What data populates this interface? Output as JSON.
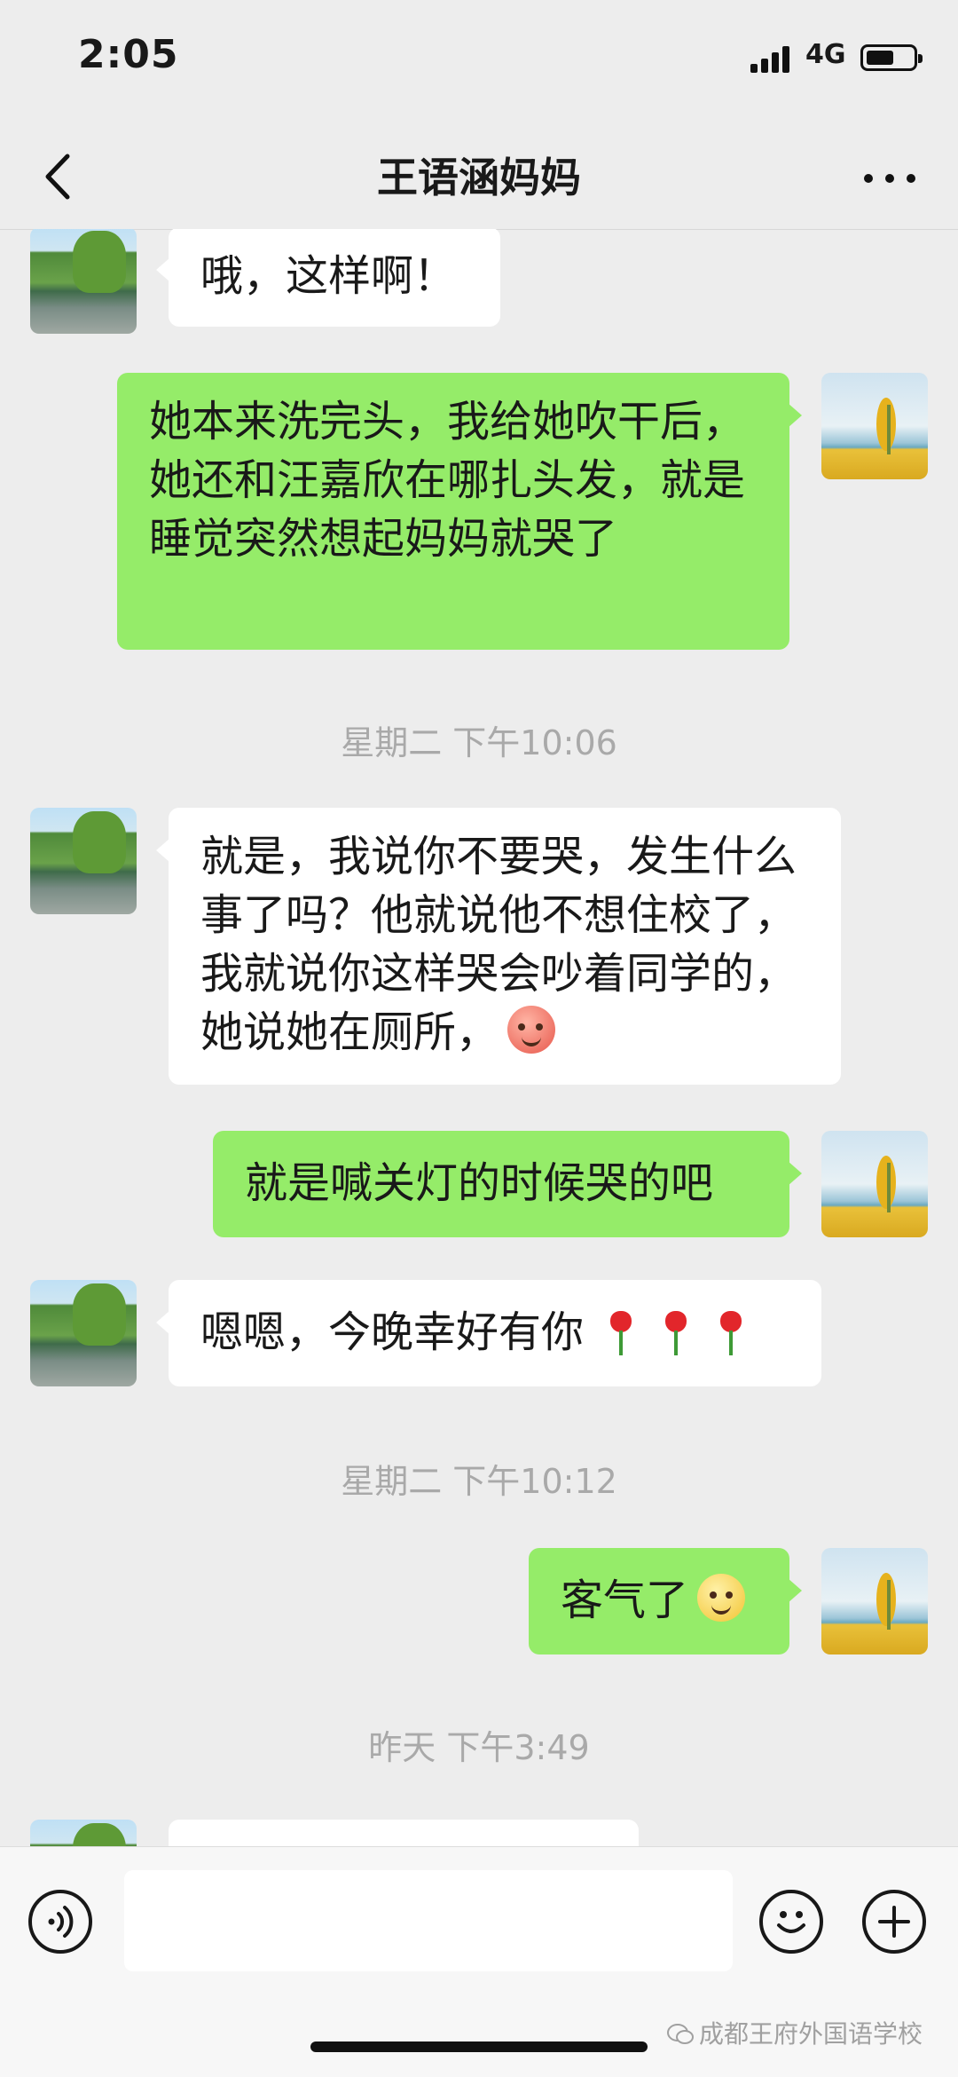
{
  "status_bar": {
    "time": "2:05",
    "network": "4G"
  },
  "header": {
    "title": "王语涵妈妈",
    "back_icon": "chevron-left-icon",
    "more_icon": "ellipsis-icon"
  },
  "messages": [
    {
      "side": "in",
      "text": "哦，这样啊！"
    },
    {
      "side": "out",
      "text": "她本来洗完头，我给她吹干后，她还和汪嘉欣在哪扎头发，就是睡觉突然想起妈妈就哭了"
    },
    {
      "side": "in",
      "text": "就是，我说你不要哭，发生什么事了吗？他就说他不想住校了，我就说你这样哭会吵着同学的，她说她在厕所，",
      "emoji": "blush-emoji"
    },
    {
      "side": "out",
      "text": "就是喊关灯的时候哭的吧"
    },
    {
      "side": "in",
      "text": "嗯嗯，今晚幸好有你",
      "emoji": "rose-emoji-x3"
    },
    {
      "side": "out",
      "text": "客气了",
      "emoji": "smile-emoji"
    }
  ],
  "timestamps": [
    "星期二 下午10:06",
    "星期二 下午10:12",
    "昨天 下午3:49"
  ],
  "watermark": "成都王府外国语学校"
}
